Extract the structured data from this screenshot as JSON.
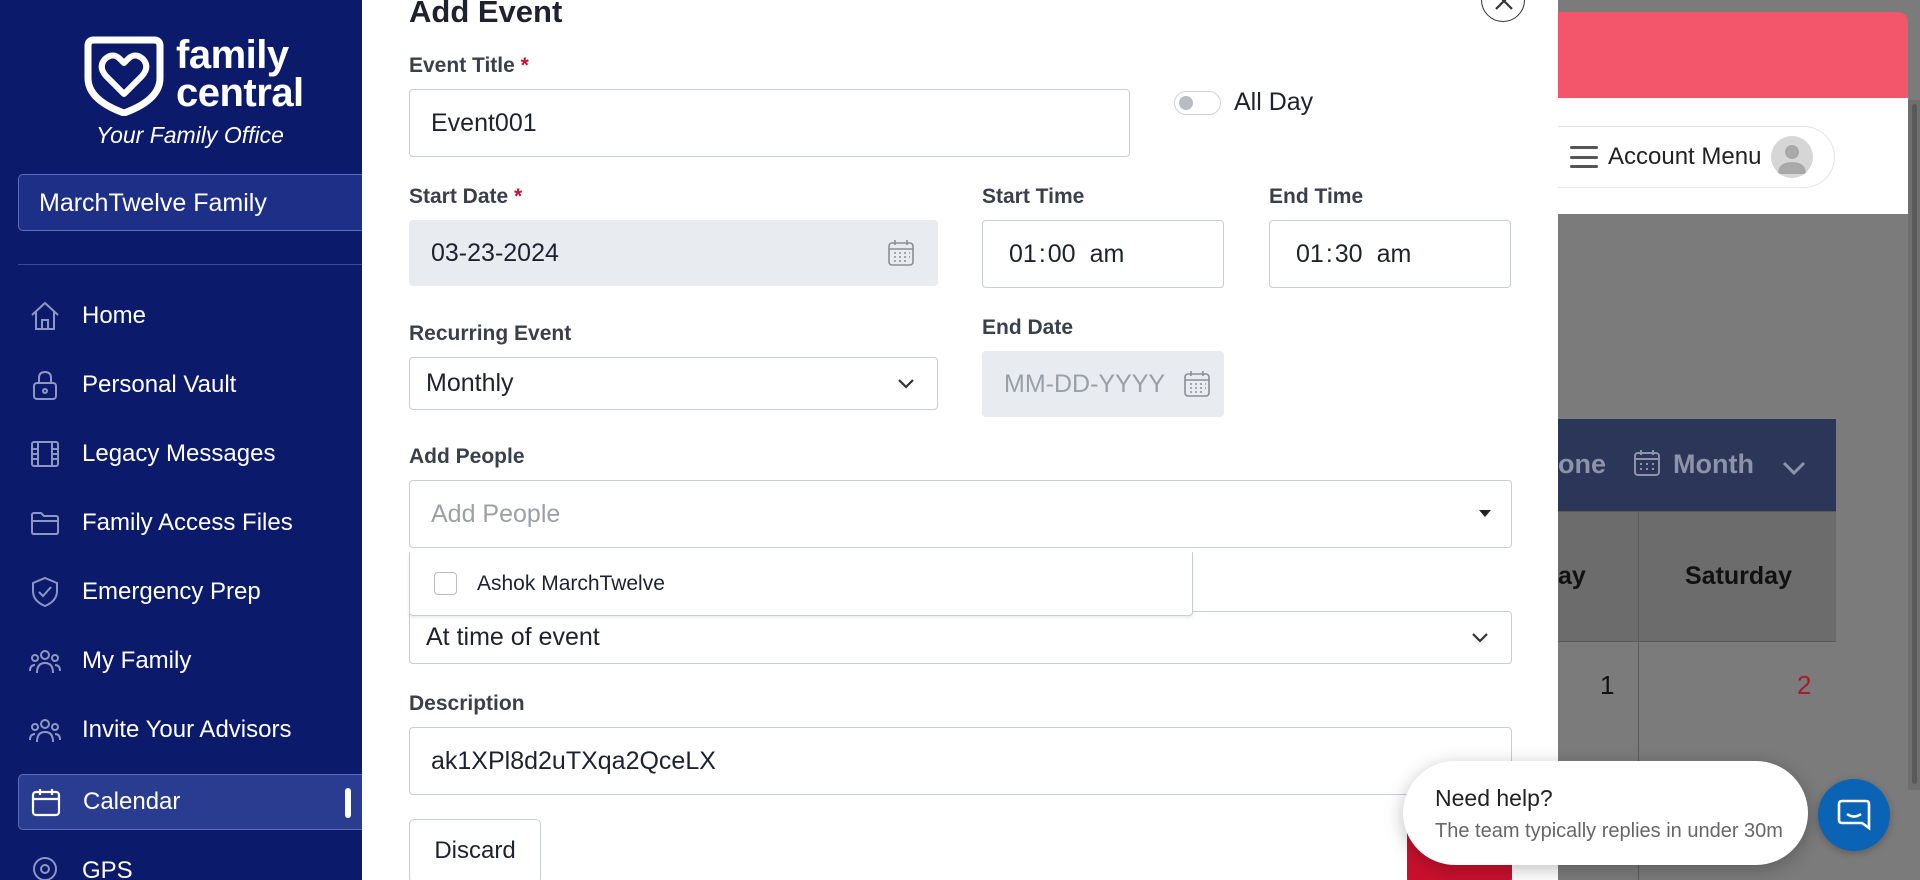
{
  "sidebar": {
    "logo": {
      "name": "family central",
      "name_line1": "family",
      "name_line2": "central",
      "tagline": "Your Family Office"
    },
    "family_select": "MarchTwelve Family",
    "items": [
      {
        "label": "Home",
        "icon": "home-icon"
      },
      {
        "label": "Personal Vault",
        "icon": "lock-icon"
      },
      {
        "label": "Legacy Messages",
        "icon": "film-icon"
      },
      {
        "label": "Family Access Files",
        "icon": "folder-icon"
      },
      {
        "label": "Emergency Prep",
        "icon": "shield-icon"
      },
      {
        "label": "My Family",
        "icon": "people-icon"
      },
      {
        "label": "Invite Your Advisors",
        "icon": "people-icon"
      },
      {
        "label": "Calendar",
        "icon": "calendar-icon",
        "active": true
      },
      {
        "label": "GPS",
        "icon": "location-icon"
      }
    ]
  },
  "background": {
    "account_menu": "Account Menu",
    "view_partial": "one",
    "view_select": "Month",
    "day_partial": "ay",
    "day_saturday": "Saturday",
    "date_1": "1",
    "date_2": "2"
  },
  "modal": {
    "title": "Add Event",
    "event_title": {
      "label": "Event Title",
      "required": "*",
      "value": "Event001"
    },
    "all_day": {
      "label": "All Day",
      "checked": false
    },
    "start_date": {
      "label": "Start Date",
      "required": "*",
      "value": "03-23-2024"
    },
    "start_time": {
      "label": "Start Time",
      "hour": "01",
      "sep": ":",
      "minute": "00",
      "ampm": "am"
    },
    "end_time": {
      "label": "End Time",
      "hour": "01",
      "sep": ":",
      "minute": "30",
      "ampm": "am"
    },
    "recurring": {
      "label": "Recurring Event",
      "value": "Monthly"
    },
    "end_date": {
      "label": "End Date",
      "placeholder": "MM-DD-YYYY"
    },
    "add_people": {
      "label": "Add People",
      "placeholder": "Add People",
      "options": [
        "Ashok MarchTwelve"
      ]
    },
    "reminder": {
      "value": "At time of event"
    },
    "description": {
      "label": "Description",
      "value": "ak1XPl8d2uTXqa2QceLX"
    },
    "discard_label": "Discard"
  },
  "help": {
    "title": "Need help?",
    "subtitle": "The team typically replies in under 30m"
  },
  "colors": {
    "sidebar_bg": "#0b1a6b",
    "accent_red": "#c8102e",
    "header_red": "#f3566a",
    "help_blue": "#0a63b5"
  }
}
